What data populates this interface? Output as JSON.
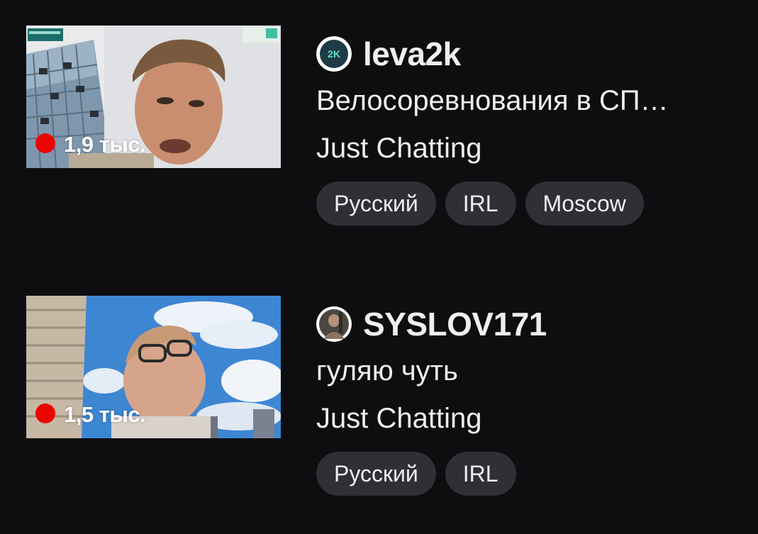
{
  "streams": [
    {
      "viewers": "1,9 тыс.",
      "channel": "leva2k",
      "avatar_text": "2K",
      "title": "Велосоревнования в СП…",
      "category": "Just Chatting",
      "tags": [
        "Русский",
        "IRL",
        "Moscow"
      ]
    },
    {
      "viewers": "1,5 тыс.",
      "channel": "SYSLOV171",
      "title": "гуляю чуть",
      "category": "Just Chatting",
      "tags": [
        "Русский",
        "IRL"
      ]
    }
  ],
  "colors": {
    "background": "#0e0e10",
    "live": "#eb0400",
    "tag_bg": "#2f2f35",
    "text": "#efeff1"
  }
}
